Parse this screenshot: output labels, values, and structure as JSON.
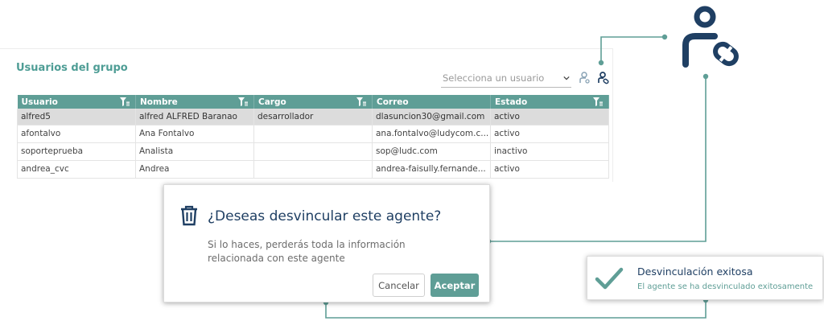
{
  "panel": {
    "title": "Usuarios del grupo",
    "select_placeholder": "Selecciona un usuario"
  },
  "table": {
    "headers": [
      "Usuario",
      "Nombre",
      "Cargo",
      "Correo",
      "Estado"
    ],
    "rows": [
      [
        "alfred5",
        "alfred ALFRED Baranao",
        "desarrollador",
        "dlasuncion30@gmail.com",
        "activo"
      ],
      [
        "afontalvo",
        "Ana Fontalvo",
        "",
        "ana.fontalvo@ludycom.c...",
        "activo"
      ],
      [
        "soporteprueba",
        "Analista",
        "",
        "sop@ludc.com",
        "inactivo"
      ],
      [
        "andrea_cvc",
        "Andrea",
        "",
        "andrea-faisully.fernande...",
        "activo"
      ]
    ]
  },
  "dialog": {
    "title": "¿Deseas desvincular este agente?",
    "body": "Si lo haces, perderás toda la información relacionada con este agente",
    "cancel_label": "Cancelar",
    "accept_label": "Aceptar"
  },
  "toast": {
    "title": "Desvinculación exitosa",
    "message": "El agente se ha desvinculado exitosamente"
  },
  "icons": {
    "add_agent": "user-add-icon",
    "unlink_agent": "user-unlink-icon",
    "filter": "filter-icon",
    "trash": "trash-icon",
    "check": "check-icon",
    "chevron": "chevron-down-icon"
  },
  "colors": {
    "accent": "#5f9e96",
    "navy": "#1f3f63",
    "selected_row": "#dcdcdc"
  }
}
